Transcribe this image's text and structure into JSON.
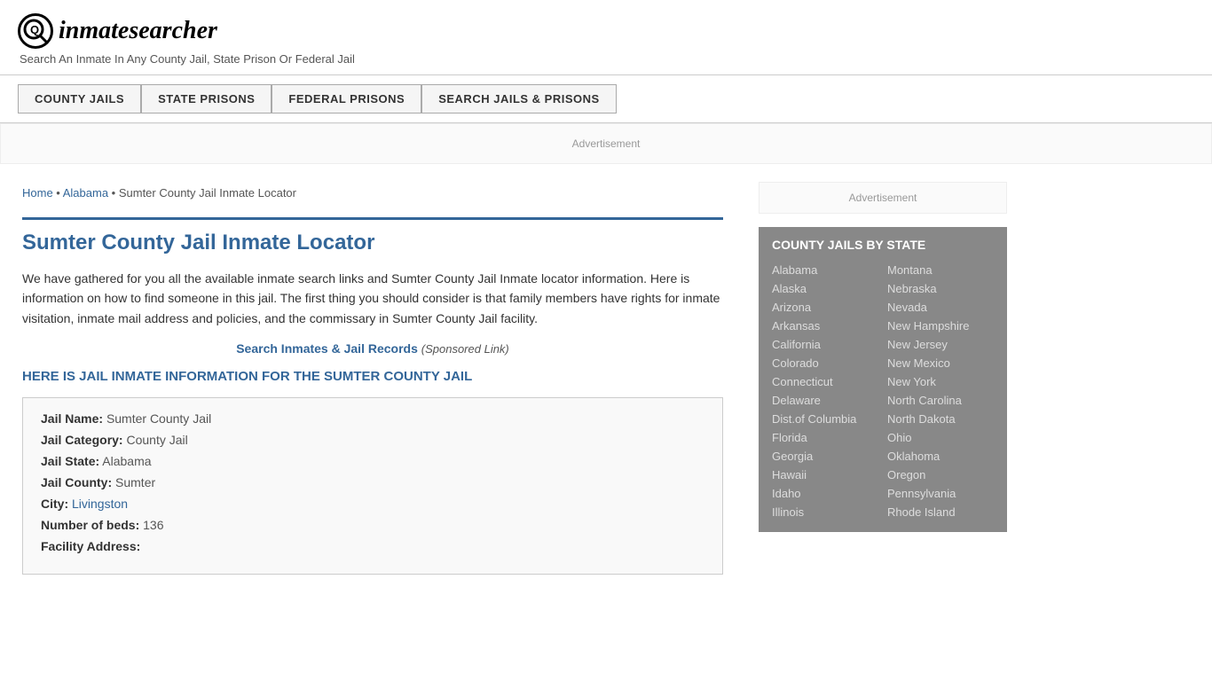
{
  "header": {
    "logo_icon": "Q",
    "logo_text_prefix": "inmate",
    "logo_text_suffix": "searcher",
    "tagline": "Search An Inmate In Any County Jail, State Prison Or Federal Jail"
  },
  "nav": {
    "items": [
      {
        "label": "COUNTY JAILS",
        "name": "county-jails"
      },
      {
        "label": "STATE PRISONS",
        "name": "state-prisons"
      },
      {
        "label": "FEDERAL PRISONS",
        "name": "federal-prisons"
      },
      {
        "label": "SEARCH JAILS & PRISONS",
        "name": "search-jails"
      }
    ]
  },
  "ad": {
    "label": "Advertisement"
  },
  "breadcrumb": {
    "home": "Home",
    "state": "Alabama",
    "page": "Sumter County Jail Inmate Locator"
  },
  "content": {
    "page_title": "Sumter County Jail Inmate Locator",
    "description": "We have gathered for you all the available inmate search links and Sumter County Jail Inmate locator information. Here is information on how to find someone in this jail. The first thing you should consider is that family members have rights for inmate visitation, inmate mail address and policies, and the commissary in Sumter County Jail facility.",
    "sponsored_link_text": "Search Inmates & Jail Records",
    "sponsored_link_suffix": "(Sponsored Link)",
    "section_heading": "HERE IS JAIL INMATE INFORMATION FOR THE SUMTER COUNTY JAIL",
    "info": {
      "jail_name_label": "Jail Name:",
      "jail_name_value": "Sumter County Jail",
      "jail_category_label": "Jail Category:",
      "jail_category_value": "County Jail",
      "jail_state_label": "Jail State:",
      "jail_state_value": "Alabama",
      "jail_county_label": "Jail County:",
      "jail_county_value": "Sumter",
      "city_label": "City:",
      "city_value": "Livingston",
      "beds_label": "Number of beds:",
      "beds_value": "136",
      "address_label": "Facility Address:"
    }
  },
  "sidebar": {
    "ad_label": "Advertisement",
    "state_box_title": "COUNTY JAILS BY STATE",
    "states_left": [
      "Alabama",
      "Alaska",
      "Arizona",
      "Arkansas",
      "California",
      "Colorado",
      "Connecticut",
      "Delaware",
      "Dist.of Columbia",
      "Florida",
      "Georgia",
      "Hawaii",
      "Idaho",
      "Illinois"
    ],
    "states_right": [
      "Montana",
      "Nebraska",
      "Nevada",
      "New Hampshire",
      "New Jersey",
      "New Mexico",
      "New York",
      "North Carolina",
      "North Dakota",
      "Ohio",
      "Oklahoma",
      "Oregon",
      "Pennsylvania",
      "Rhode Island"
    ]
  }
}
